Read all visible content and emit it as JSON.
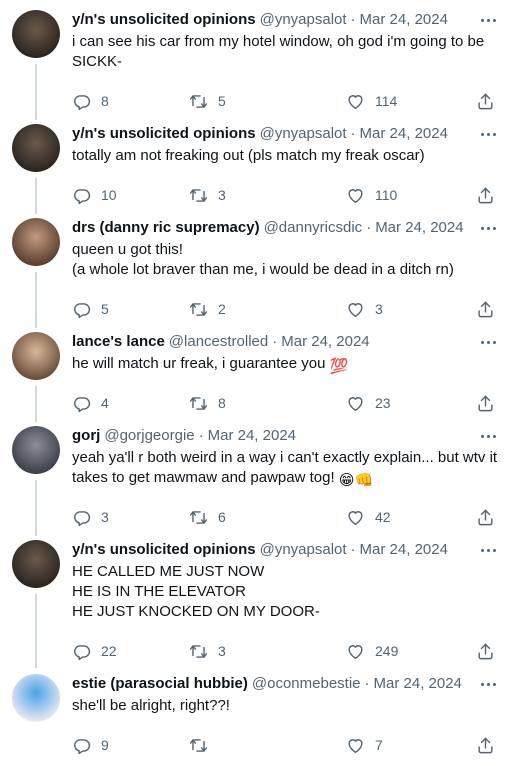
{
  "tweets": [
    {
      "name": "y/n's unsolicited opinions",
      "handle": "@ynyapsalot",
      "date": "Mar 24, 2024",
      "text": "i can see his car from my hotel window, oh god i'm going to be SICKK-",
      "replies": "8",
      "retweets": "5",
      "likes": "114",
      "avatar_colors": [
        "#6b5a4a",
        "#2a2420"
      ]
    },
    {
      "name": "y/n's unsolicited opinions",
      "handle": "@ynyapsalot",
      "date": "Mar 24, 2024",
      "text": "totally am not freaking out (pls match my freak oscar)",
      "replies": "10",
      "retweets": "3",
      "likes": "110",
      "avatar_colors": [
        "#6b5a4a",
        "#2a2420"
      ]
    },
    {
      "name": "drs (danny ric supremacy)",
      "handle": "@dannyricsdic",
      "date": "Mar 24, 2024",
      "text": "queen u got this!\n(a whole lot braver than me, i would be dead in a ditch rn)",
      "replies": "5",
      "retweets": "2",
      "likes": "3",
      "avatar_colors": [
        "#c09a80",
        "#5a3e2e"
      ]
    },
    {
      "name": "lance's lance",
      "handle": "@lancestrolled",
      "date": "Mar 24, 2024",
      "text": "he will match ur freak, i guarantee you",
      "emoji": "💯",
      "replies": "4",
      "retweets": "8",
      "likes": "23",
      "avatar_colors": [
        "#d8b89a",
        "#6a4c3a"
      ]
    },
    {
      "name": "gorj",
      "handle": "@gorjgeorgie",
      "date": "Mar 24, 2024",
      "text": "yeah ya'll r both weird in a way i can't exactly explain... but wtv it takes to get mawmaw and pawpaw tog!",
      "emoji": "😁👊",
      "replies": "3",
      "retweets": "6",
      "likes": "42",
      "avatar_colors": [
        "#8a8f99",
        "#3b3f48"
      ]
    },
    {
      "name": "y/n's unsolicited opinions",
      "handle": "@ynyapsalot",
      "date": "Mar 24, 2024",
      "text": "HE CALLED ME JUST NOW\nHE IS IN THE ELEVATOR\nHE JUST KNOCKED ON MY DOOR-",
      "replies": "22",
      "retweets": "3",
      "likes": "249",
      "avatar_colors": [
        "#6b5a4a",
        "#2a2420"
      ]
    },
    {
      "name": "estie (parasocial hubbie)",
      "handle": "@oconmebestie",
      "date": "Mar 24, 2024",
      "text": "she'll be alright, right??!",
      "replies": "9",
      "retweets": "",
      "likes": "7",
      "avatar_colors": [
        "#4aa3e8",
        "#e8e8f0"
      ]
    }
  ],
  "icons": {
    "reply": "reply-icon",
    "retweet": "retweet-icon",
    "like": "heart-icon",
    "share": "share-icon",
    "more": "more-icon"
  }
}
